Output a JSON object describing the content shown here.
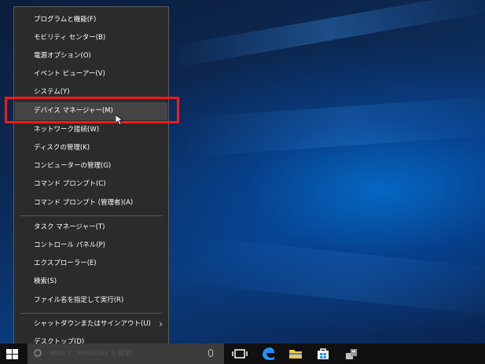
{
  "context_menu": {
    "groups": [
      [
        {
          "label": "プログラムと機能(F)"
        },
        {
          "label": "モビリティ センター(B)"
        },
        {
          "label": "電源オプション(O)"
        },
        {
          "label": "イベント ビューアー(V)"
        },
        {
          "label": "システム(Y)"
        },
        {
          "label": "デバイス マネージャー(M)",
          "state": "hover",
          "annotated": true
        },
        {
          "label": "ネットワーク接続(W)"
        },
        {
          "label": "ディスクの管理(K)"
        },
        {
          "label": "コンピューターの管理(G)"
        },
        {
          "label": "コマンド プロンプト(C)"
        },
        {
          "label": "コマンド プロンプト (管理者)(A)"
        }
      ],
      [
        {
          "label": "タスク マネージャー(T)"
        },
        {
          "label": "コントロール パネル(P)"
        },
        {
          "label": "エクスプローラー(E)"
        },
        {
          "label": "検索(S)"
        },
        {
          "label": "ファイル名を指定して実行(R)"
        }
      ],
      [
        {
          "label": "シャットダウンまたはサインアウト(U)",
          "has_submenu": true
        },
        {
          "label": "デスクトップ(D)"
        }
      ]
    ]
  },
  "taskbar": {
    "search_placeholder": "Web と Windows を検索",
    "icons": [
      "start-icon",
      "search-icon",
      "microphone-icon",
      "task-view-icon",
      "edge-icon",
      "file-explorer-icon",
      "store-icon",
      "app-icon"
    ]
  },
  "colors": {
    "menu_bg": "#2b2b2b",
    "menu_hover": "#444444",
    "annotation": "#ee1c1c",
    "taskbar": "#101010",
    "edge_blue": "#1e90ff",
    "explorer_yellow": "#f4c542"
  }
}
